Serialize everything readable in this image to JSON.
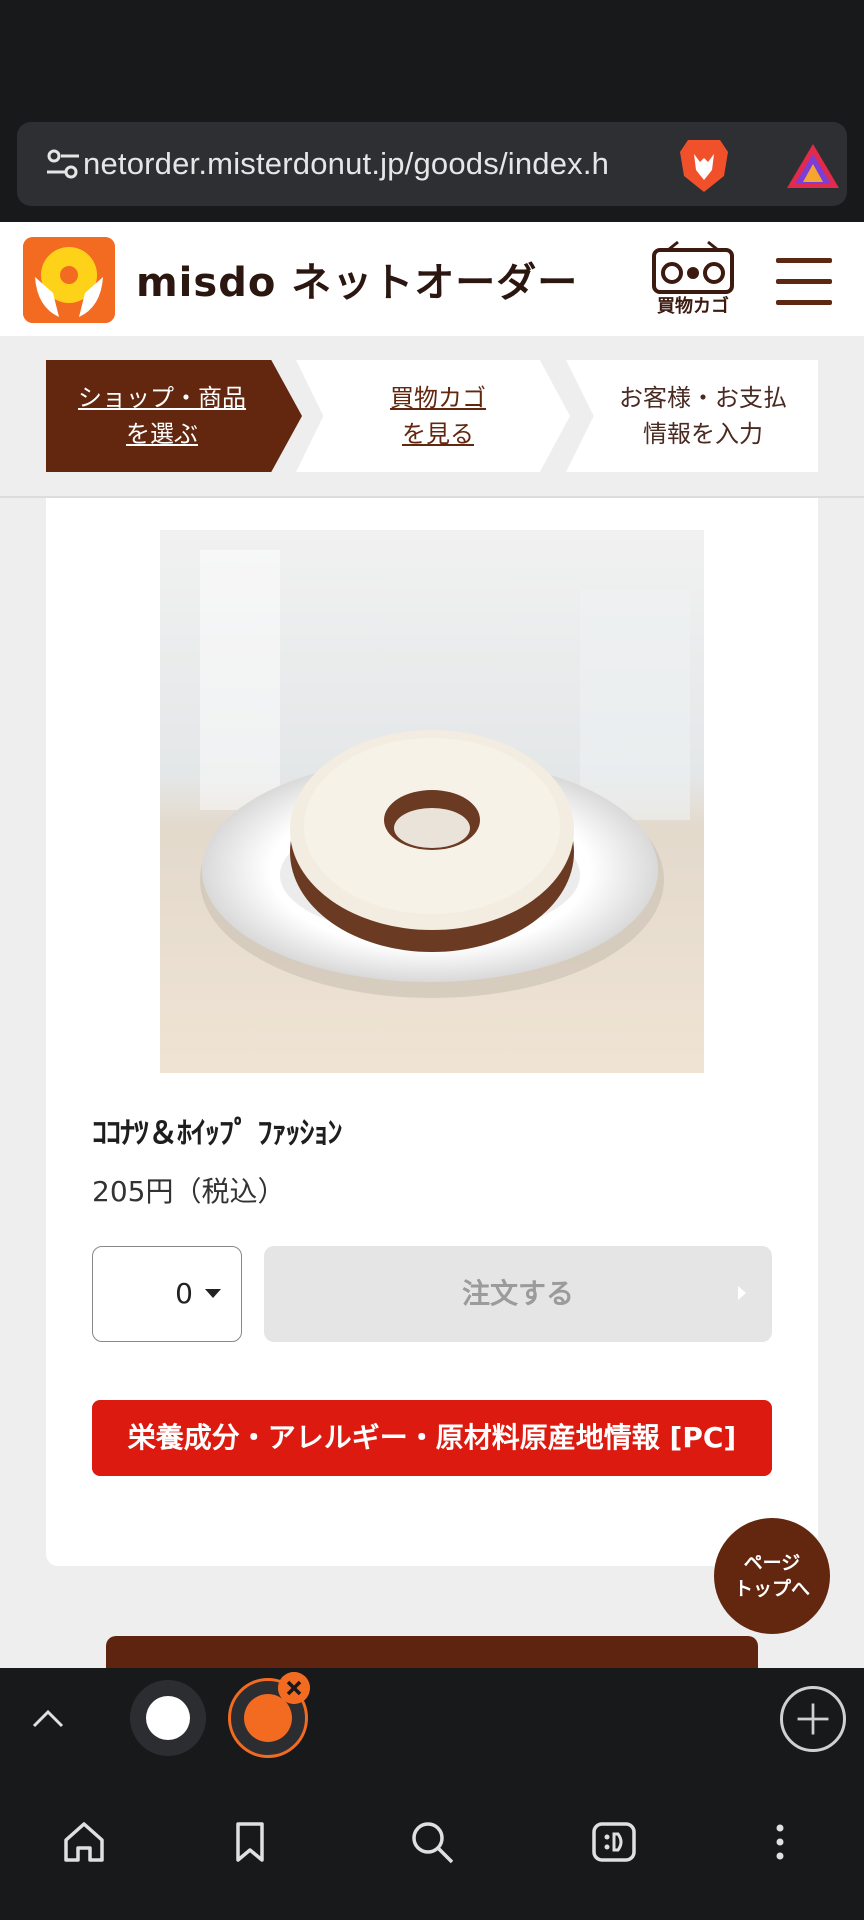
{
  "browser": {
    "url": "netorder.misterdonut.jp/goods/index.h",
    "icons": [
      "settings-sliders-icon",
      "brave-lion-icon",
      "brave-rewards-icon"
    ]
  },
  "header": {
    "brand": "misdo ネットオーダー",
    "cart_label": "買物カゴ",
    "icons": [
      "misdo-logo",
      "cart-radio-icon",
      "hamburger-menu-icon"
    ]
  },
  "steps": [
    {
      "line1": "ショップ・商品",
      "line2": "を選ぶ"
    },
    {
      "line1": "買物カゴ",
      "line2": "を見る"
    },
    {
      "line1": "お客様・お支払",
      "line2": "情報を入力"
    }
  ],
  "product": {
    "name": "ｺｺﾅﾂ＆ﾎｲｯﾌﾟ ﾌｧｯｼｮﾝ",
    "price": "205円（税込）",
    "quantity": "0",
    "order_label": "注文する",
    "nutrition_label": "栄養成分・アレルギー・原材料原産地情報 [PC]"
  },
  "page_top": {
    "line1": "ページ",
    "line2": "トップへ"
  },
  "bottom_bar": {
    "icons": [
      "chevron-up-icon",
      "tab-thumbnail",
      "tab-thumbnail-active",
      "close-tab-icon",
      "new-tab-plus-icon",
      "home-icon",
      "bookmark-icon",
      "search-icon",
      "leo-ai-icon",
      "more-vertical-icon"
    ]
  },
  "colors": {
    "brand_brown": "#63270f",
    "brand_orange": "#f26b21",
    "alert_red": "#dd1a10",
    "browser_dark": "#18191b"
  }
}
